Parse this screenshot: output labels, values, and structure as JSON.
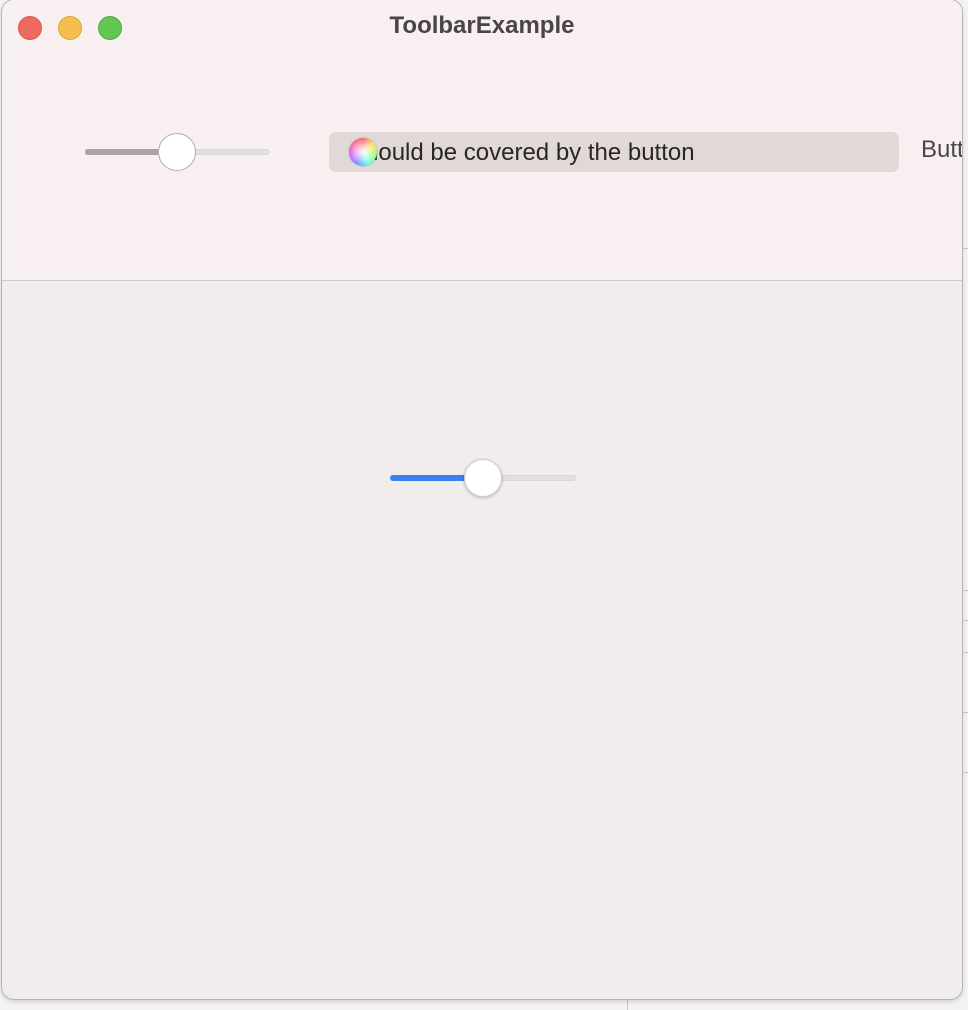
{
  "window": {
    "title": "ToolbarExample"
  },
  "toolbar": {
    "slider": {
      "value": 0.5,
      "state": "inactive"
    },
    "text_field": {
      "value": "Should be covered by the button"
    },
    "button": {
      "label": "Button"
    },
    "color_well": {
      "icon": "color-wheel-icon"
    }
  },
  "content": {
    "slider": {
      "value": 0.5,
      "accent": "#3a82f0"
    }
  },
  "colors": {
    "close": "#ee6a5e",
    "minimize": "#f5bf4f",
    "zoom": "#62c554",
    "accent": "#3a82f0"
  }
}
